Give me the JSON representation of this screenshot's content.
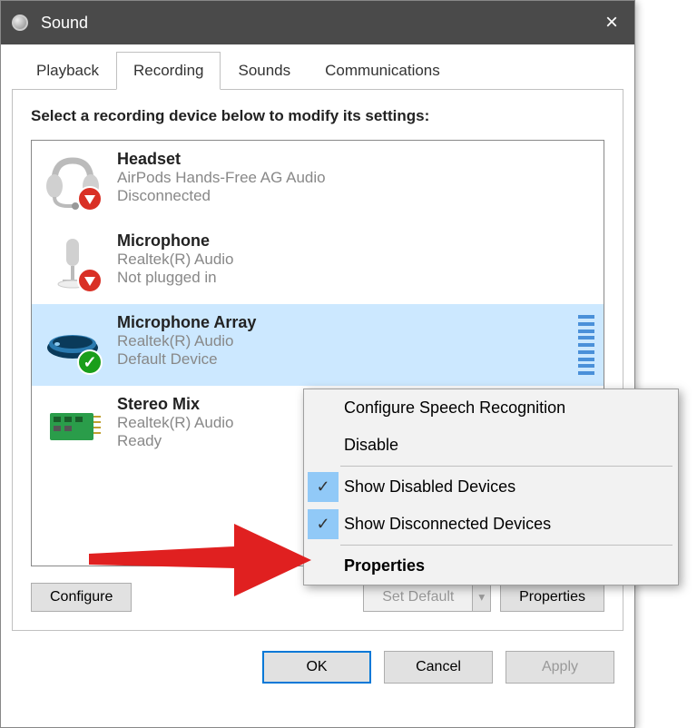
{
  "window": {
    "title": "Sound"
  },
  "tabs": [
    {
      "id": "playback",
      "label": "Playback",
      "active": false
    },
    {
      "id": "recording",
      "label": "Recording",
      "active": true
    },
    {
      "id": "sounds",
      "label": "Sounds",
      "active": false
    },
    {
      "id": "communications",
      "label": "Communications",
      "active": false
    }
  ],
  "instruction": "Select a recording device below to modify its settings:",
  "devices": [
    {
      "id": "headset",
      "name": "Headset",
      "driver": "AirPods Hands-Free AG Audio",
      "status": "Disconnected",
      "icon": "headset-icon",
      "badge": "red",
      "selected": false
    },
    {
      "id": "microphone",
      "name": "Microphone",
      "driver": "Realtek(R) Audio",
      "status": "Not plugged in",
      "icon": "microphone-icon",
      "badge": "red",
      "selected": false
    },
    {
      "id": "mic-array",
      "name": "Microphone Array",
      "driver": "Realtek(R) Audio",
      "status": "Default Device",
      "icon": "mic-array-icon",
      "badge": "green",
      "selected": true,
      "level_meter": true
    },
    {
      "id": "stereo-mix",
      "name": "Stereo Mix",
      "driver": "Realtek(R) Audio",
      "status": "Ready",
      "icon": "stereo-mix-icon",
      "badge": null,
      "selected": false
    }
  ],
  "buttons": {
    "configure": "Configure",
    "set_default": "Set Default",
    "properties": "Properties",
    "ok": "OK",
    "cancel": "Cancel",
    "apply": "Apply"
  },
  "context_menu": {
    "items": [
      {
        "id": "configure-speech",
        "label": "Configure Speech Recognition",
        "checked": false
      },
      {
        "id": "disable",
        "label": "Disable",
        "checked": false
      },
      {
        "separator": true
      },
      {
        "id": "show-disabled",
        "label": "Show Disabled Devices",
        "checked": true
      },
      {
        "id": "show-disconnected",
        "label": "Show Disconnected Devices",
        "checked": true
      },
      {
        "separator": true
      },
      {
        "id": "cm-properties",
        "label": "Properties",
        "bold": true
      }
    ]
  }
}
